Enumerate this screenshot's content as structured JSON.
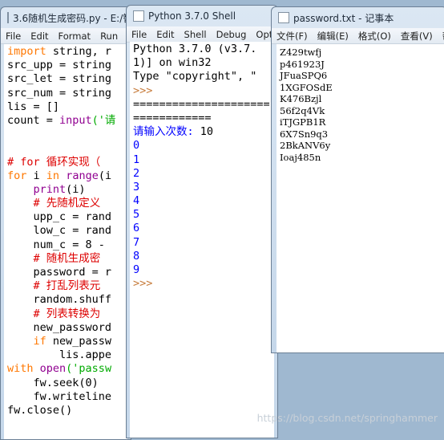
{
  "editor": {
    "title": "3.6随机生成密码.py - E:/智",
    "menu": [
      "File",
      "Edit",
      "Format",
      "Run"
    ],
    "lines": [
      [
        [
          "import",
          "kw"
        ],
        [
          " string, r",
          ""
        ]
      ],
      [
        [
          "src_upp = string",
          ""
        ]
      ],
      [
        [
          "src_let = string",
          ""
        ]
      ],
      [
        [
          "src_num = string",
          ""
        ]
      ],
      [
        [
          "lis = []",
          ""
        ]
      ],
      [
        [
          "count = ",
          ""
        ],
        [
          "input",
          "bi"
        ],
        [
          "('请",
          "st"
        ]
      ],
      [],
      [],
      [
        [
          "# for 循环实现（",
          "cm"
        ]
      ],
      [
        [
          "for",
          "kw"
        ],
        [
          " i ",
          ""
        ],
        [
          "in",
          "kw"
        ],
        [
          " ",
          ""
        ],
        [
          "range",
          "bi"
        ],
        [
          "(i",
          ""
        ]
      ],
      [
        [
          "    ",
          ""
        ],
        [
          "print",
          "bi"
        ],
        [
          "(i)",
          ""
        ]
      ],
      [
        [
          "    # 先随机定义",
          "cm"
        ]
      ],
      [
        [
          "    upp_c = rand",
          ""
        ]
      ],
      [
        [
          "    low_c = rand",
          ""
        ]
      ],
      [
        [
          "    num_c = 8 -",
          ""
        ]
      ],
      [
        [
          "    # 随机生成密",
          "cm"
        ]
      ],
      [
        [
          "    password = r",
          ""
        ]
      ],
      [
        [
          "    # 打乱列表元",
          "cm"
        ]
      ],
      [
        [
          "    random.shuff",
          ""
        ]
      ],
      [
        [
          "    # 列表转换为",
          "cm"
        ]
      ],
      [
        [
          "    new_password",
          ""
        ]
      ],
      [
        [
          "    ",
          ""
        ],
        [
          "if",
          "kw"
        ],
        [
          " new_passw",
          ""
        ]
      ],
      [
        [
          "        lis.appe",
          ""
        ]
      ],
      [
        [
          "with",
          "kw"
        ],
        [
          " ",
          ""
        ],
        [
          "open",
          "bi"
        ],
        [
          "('passw",
          "st"
        ]
      ],
      [
        [
          "    fw.seek(0)",
          ""
        ]
      ],
      [
        [
          "    fw.writeline",
          ""
        ]
      ],
      [
        [
          "fw.close()",
          ""
        ]
      ]
    ]
  },
  "shell": {
    "title": "Python 3.7.0 Shell",
    "menu": [
      "File",
      "Edit",
      "Shell",
      "Debug",
      "Opti"
    ],
    "lines": [
      [
        [
          "Python 3.7.0 (v3.7.",
          ""
        ]
      ],
      [
        [
          "1)] on win32",
          ""
        ]
      ],
      [
        [
          "Type \"copyright\", \"",
          ""
        ]
      ],
      [
        [
          ">>> ",
          "pr"
        ]
      ],
      [
        [
          "=====================",
          ""
        ]
      ],
      [
        [
          "============",
          ""
        ]
      ],
      [
        [
          "请输入次数: ",
          "out"
        ],
        [
          "10",
          ""
        ]
      ],
      [
        [
          "0",
          "out"
        ]
      ],
      [
        [
          "1",
          "out"
        ]
      ],
      [
        [
          "2",
          "out"
        ]
      ],
      [
        [
          "3",
          "out"
        ]
      ],
      [
        [
          "4",
          "out"
        ]
      ],
      [
        [
          "5",
          "out"
        ]
      ],
      [
        [
          "6",
          "out"
        ]
      ],
      [
        [
          "7",
          "out"
        ]
      ],
      [
        [
          "8",
          "out"
        ]
      ],
      [
        [
          "9",
          "out"
        ]
      ],
      [
        [
          ">>> ",
          "pr"
        ]
      ]
    ]
  },
  "notepad": {
    "title": "password.txt - 记事本",
    "menu": [
      "文件(F)",
      "编辑(E)",
      "格式(O)",
      "查看(V)",
      "帮"
    ],
    "lines": [
      "Z429twfj",
      "p461923J",
      "JFuaSPQ6",
      "1XGFOSdE",
      "K476Bzjl",
      "56f2q4Vk",
      "iTJGPB1R",
      "6X7Sn9q3",
      "2BkANV6y",
      "Ioaj485n"
    ]
  },
  "watermark": "https://blog.csdn.net/springhammer"
}
